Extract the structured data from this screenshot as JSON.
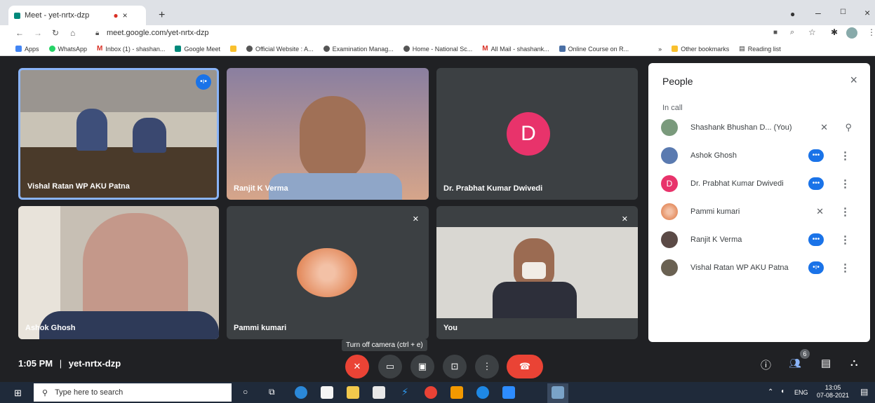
{
  "browser": {
    "tab_title": "Meet - yet-nrtx-dzp",
    "url": "meet.google.com/yet-nrtx-dzp",
    "bookmarks": [
      "Apps",
      "WhatsApp",
      "Inbox (1) - shashan...",
      "Google Meet",
      "",
      "Official Website : A...",
      "Examination Manag...",
      "Home - National Sc...",
      "All Mail - shashank...",
      "Online Course on R..."
    ],
    "other_bookmarks": "Other bookmarks",
    "reading_list": "Reading list"
  },
  "tiles": [
    {
      "name": "Vishal Ratan WP AKU Patna"
    },
    {
      "name": "Ranjit K Verma"
    },
    {
      "name": "Dr. Prabhat Kumar Dwivedi",
      "initial": "D"
    },
    {
      "name": "Ashok Ghosh"
    },
    {
      "name": "Pammi kumari"
    },
    {
      "name": "You"
    }
  ],
  "people": {
    "title": "People",
    "section": "In call",
    "list": [
      {
        "name": "Shashank Bhushan D...",
        "suffix": "(You)"
      },
      {
        "name": "Ashok Ghosh"
      },
      {
        "name": "Dr. Prabhat Kumar Dwivedi",
        "initial": "D"
      },
      {
        "name": "Pammi kumari"
      },
      {
        "name": "Ranjit K Verma"
      },
      {
        "name": "Vishal Ratan WP AKU Patna"
      }
    ]
  },
  "meeting": {
    "time": "1:05 PM",
    "separator": "|",
    "code": "yet-nrtx-dzp",
    "tooltip": "Turn off camera (ctrl + e)",
    "participant_count": "6"
  },
  "taskbar": {
    "search_placeholder": "Type here to search",
    "lang": "ENG",
    "clock_time": "13:05",
    "clock_date": "07-08-2021"
  },
  "colors": {
    "accent": "#1a73e8",
    "end_call": "#ea4335",
    "avatar_pink": "#e8336b"
  }
}
